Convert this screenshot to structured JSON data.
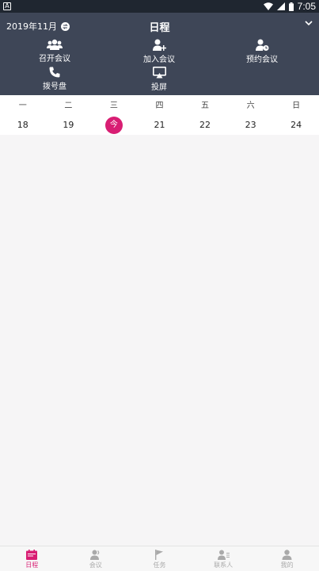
{
  "statusbar": {
    "time": "7:05",
    "app_badge": "A"
  },
  "header": {
    "month": "2019年11月",
    "title": "日程",
    "actions": [
      {
        "label": "召开会议",
        "icon": "group-icon"
      },
      {
        "label": "加入会议",
        "icon": "person-add-icon"
      },
      {
        "label": "预约会议",
        "icon": "person-clock-icon"
      },
      {
        "label": "拨号盘",
        "icon": "phone-icon"
      },
      {
        "label": "投屏",
        "icon": "cast-screen-icon"
      }
    ]
  },
  "calendar": {
    "weekdays": [
      "一",
      "二",
      "三",
      "四",
      "五",
      "六",
      "日"
    ],
    "days": [
      "18",
      "19",
      "今",
      "21",
      "22",
      "23",
      "24"
    ],
    "today_index": 2
  },
  "tabbar": {
    "tabs": [
      {
        "label": "日程",
        "icon": "calendar-icon",
        "active": true
      },
      {
        "label": "会议",
        "icon": "meeting-icon",
        "active": false
      },
      {
        "label": "任务",
        "icon": "flag-icon",
        "active": false
      },
      {
        "label": "联系人",
        "icon": "contacts-icon",
        "active": false
      },
      {
        "label": "我的",
        "icon": "profile-icon",
        "active": false
      }
    ]
  },
  "colors": {
    "header_bg": "#3e4657",
    "accent": "#d81e73",
    "statusbar_bg": "#1f2630"
  }
}
